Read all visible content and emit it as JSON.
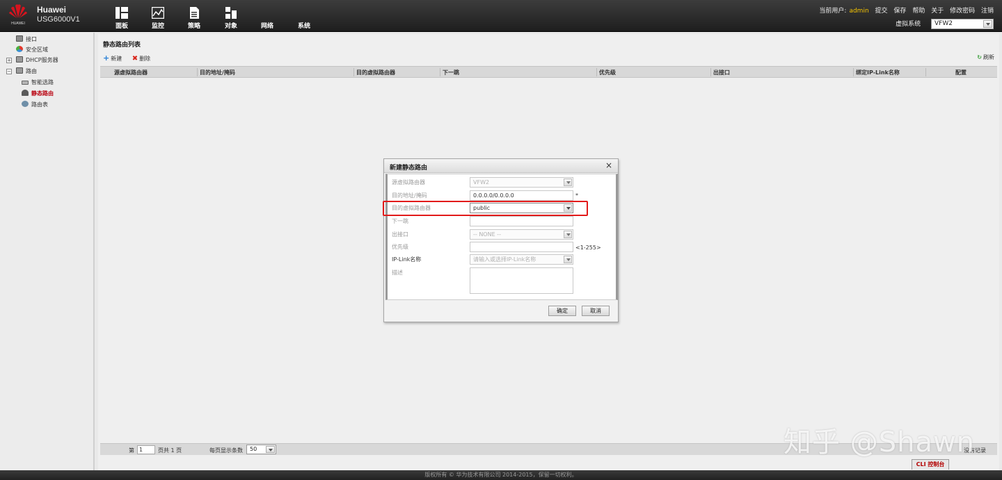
{
  "header": {
    "brand": "HUAWEI",
    "product_name": "Huawei",
    "product_model": "USG6000V1",
    "nav": [
      {
        "label": "面板",
        "icon": "dashboard-icon"
      },
      {
        "label": "监控",
        "icon": "monitor-icon"
      },
      {
        "label": "策略",
        "icon": "policy-icon"
      },
      {
        "label": "对象",
        "icon": "object-icon"
      },
      {
        "label": "网络",
        "icon": "network-icon"
      },
      {
        "label": "系统",
        "icon": "system-icon"
      }
    ],
    "current_user_label": "当前用户:",
    "current_user": "admin",
    "links": [
      "提交",
      "保存",
      "帮助",
      "关于",
      "修改密码",
      "注销"
    ],
    "vsys_label": "虚拟系统",
    "vsys_value": "VFW2"
  },
  "sidebar": {
    "items": [
      {
        "label": "接口",
        "icon": "interface-icon"
      },
      {
        "label": "安全区域",
        "icon": "security-zone-icon"
      },
      {
        "label": "DHCP服务器",
        "icon": "dhcp-icon",
        "expander": "+"
      },
      {
        "label": "路由",
        "icon": "route-icon",
        "expander": "−"
      },
      {
        "label": "智能选路",
        "icon": "smart-route-icon"
      },
      {
        "label": "静态路由",
        "icon": "static-route-icon"
      },
      {
        "label": "路由表",
        "icon": "route-table-icon"
      }
    ]
  },
  "main": {
    "title": "静态路由列表",
    "new_label": "新建",
    "delete_label": "删除",
    "refresh_label": "刷新",
    "columns": [
      "源虚拟路由器",
      "目的地址/掩码",
      "目的虚拟路由器",
      "下一跳",
      "优先级",
      "出接口",
      "绑定IP-Link名称",
      "配置"
    ],
    "pager": {
      "page_prefix": "第",
      "page": "1",
      "page_total": "页共 1 页",
      "per_page_label": "每页显示条数",
      "per_page": "50"
    },
    "no_records": "没有记录"
  },
  "dialog": {
    "title": "新建静态路由",
    "close": "×",
    "fields": {
      "src_vr": {
        "label": "源虚拟路由器",
        "value": "VFW2"
      },
      "dest": {
        "label": "目的地址/掩码",
        "value": "0.0.0.0/0.0.0.0",
        "note": "*"
      },
      "dest_vr": {
        "label": "目的虚拟路由器",
        "value": "public"
      },
      "next_hop": {
        "label": "下一跳",
        "value": ""
      },
      "out_if": {
        "label": "出接口",
        "value": "-- NONE --"
      },
      "priority": {
        "label": "优先级",
        "value": "",
        "note": "<1-255>"
      },
      "iplink": {
        "label": "IP-Link名称",
        "placeholder": "请输入或选择IP-Link名称"
      },
      "desc": {
        "label": "描述",
        "value": ""
      }
    },
    "ok_label": "确定",
    "cancel_label": "取消"
  },
  "watermark": "知乎 @Shawn",
  "cli_label": "CLI 控制台",
  "footer": "版权所有 © 华为技术有限公司 2014-2015，保留一切权利。",
  "colors": {
    "highlight": "#e21a1a",
    "user": "#f5c400",
    "active_tree": "#b8000e"
  }
}
